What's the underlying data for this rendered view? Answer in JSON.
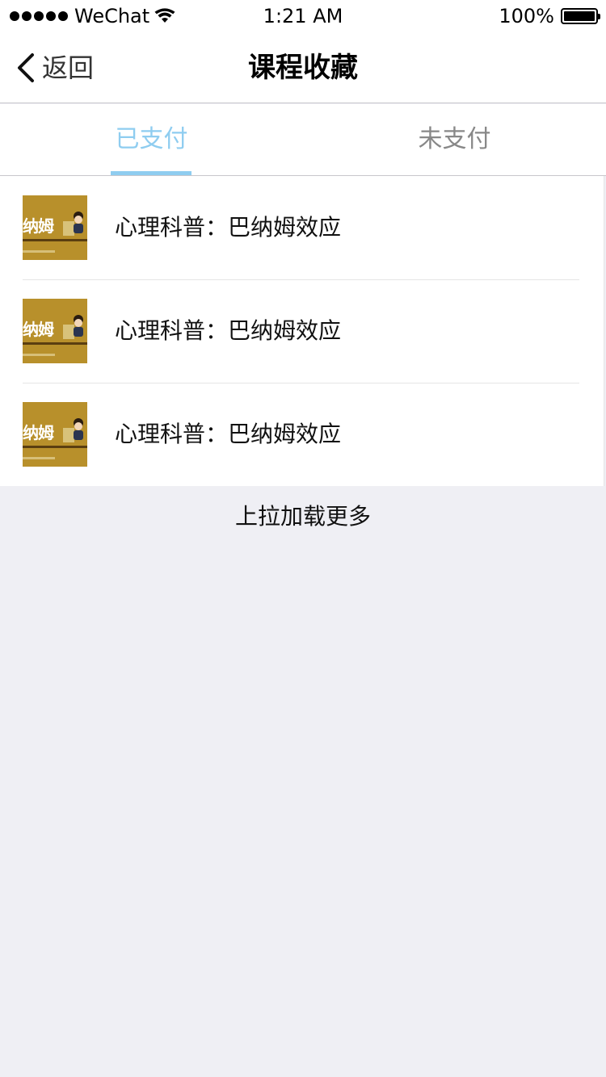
{
  "status_bar": {
    "carrier": "WeChat",
    "time": "1:21 AM",
    "battery": "100%",
    "battery_level": 1.0,
    "signal_bars": 5
  },
  "navbar": {
    "back_label": "返回",
    "title": "课程收藏"
  },
  "tabs": [
    {
      "label": "已支付",
      "active": true
    },
    {
      "label": "未支付",
      "active": false
    }
  ],
  "courses": [
    {
      "title": "心理科普：巴纳姆效应",
      "thumb_text": "纳姆"
    },
    {
      "title": "心理科普：巴纳姆效应",
      "thumb_text": "纳姆"
    },
    {
      "title": "心理科普：巴纳姆效应",
      "thumb_text": "纳姆"
    }
  ],
  "load_more": "上拉加载更多",
  "colors": {
    "accent": "#8fcdf0",
    "thumb_bg": "#b8902b",
    "page_bg": "#efeff4"
  }
}
